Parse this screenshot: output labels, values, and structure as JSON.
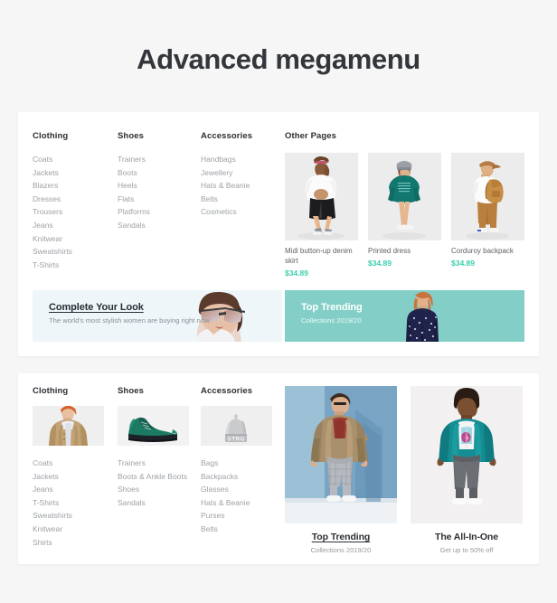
{
  "page": {
    "title": "Advanced megamenu",
    "background": "#f6f6f7",
    "accent_price": "#3bcfae",
    "banner_teal": "#83cfc7",
    "banner_blue": "#eef6fa"
  },
  "panel1": {
    "columns": [
      {
        "heading": "Clothing",
        "items": [
          "Coats",
          "Jackets",
          "Blazers",
          "Dresses",
          "Trousers",
          "Jeans",
          "Knitwear",
          "Sweatshirts",
          "T-Shirts"
        ]
      },
      {
        "heading": "Shoes",
        "items": [
          "Trainers",
          "Boots",
          "Heels",
          "Flats",
          "Platforms",
          "Sandals"
        ]
      },
      {
        "heading": "Accessories",
        "items": [
          "Handbags",
          "Jewellery",
          "Hats & Beanie",
          "Belts",
          "Cosmetics"
        ]
      }
    ],
    "other_pages": {
      "heading": "Other Pages",
      "products": [
        {
          "name": "Midi button-up denim skirt",
          "price": "$34.89",
          "image": "woman-denim-skirt"
        },
        {
          "name": "Printed dress",
          "price": "$34.89",
          "image": "woman-teal-dress"
        },
        {
          "name": "Corduroy backpack",
          "price": "$34.89",
          "image": "man-corduroy-backpack"
        }
      ]
    },
    "banners": [
      {
        "title": "Complete Your Look",
        "subtitle": "The world's most stylish women are buying right now.",
        "image": "woman-sunglasses"
      },
      {
        "title": "Top Trending",
        "subtitle": "Collections 2019/20",
        "image": "woman-floral-jacket"
      }
    ]
  },
  "panel2": {
    "columns": [
      {
        "heading": "Clothing",
        "image": "man-tan-coat",
        "items": [
          "Coats",
          "Jackets",
          "Jeans",
          "T-Shirts",
          "Sweatshirts",
          "Knitwear",
          "Shirts"
        ]
      },
      {
        "heading": "Shoes",
        "image": "green-sneaker",
        "items": [
          "Trainers",
          "Boots & Ankle Boots",
          "Shoes",
          "Sandals"
        ]
      },
      {
        "heading": "Accessories",
        "image": "grey-beanie",
        "items": [
          "Bags",
          "Backpacks",
          "Glasses",
          "Hats & Beanie",
          "Purses",
          "Belts"
        ]
      }
    ],
    "cards": [
      {
        "title": "Top Trending",
        "subtitle": "Collections 2019/20",
        "image": "man-trench-coat-blue-wall",
        "underline": true
      },
      {
        "title": "The All-In-One",
        "subtitle": "Get up to 50% off",
        "image": "man-teal-jacket",
        "underline": false
      }
    ]
  }
}
